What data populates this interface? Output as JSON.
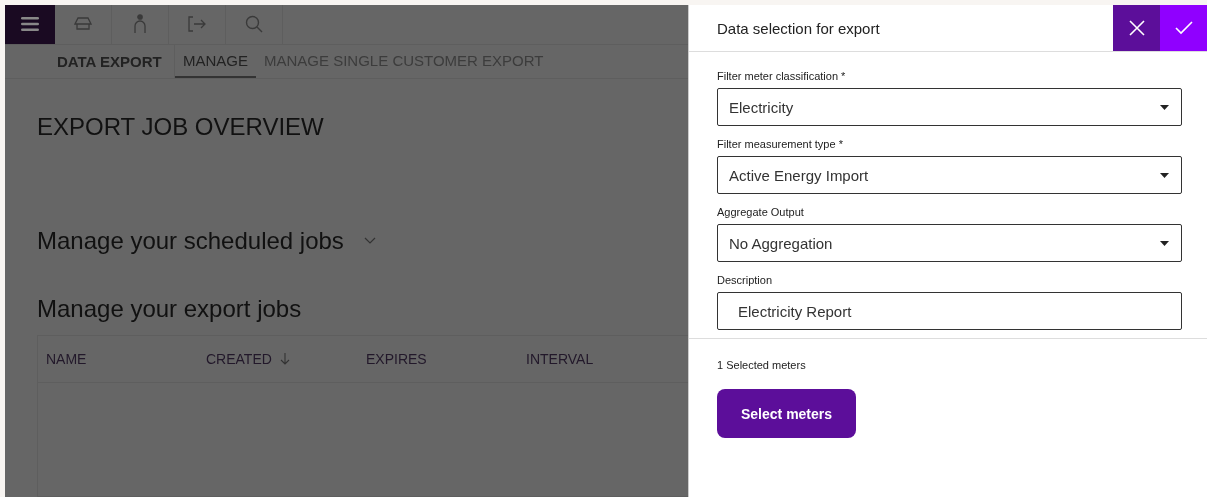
{
  "app_tabs": [
    {
      "label": "DATA EXPORT",
      "kind": "section"
    },
    {
      "label": "MANAGE",
      "kind": "tab",
      "selected": true
    },
    {
      "label": "MANAGE SINGLE CUSTOMER EXPORT",
      "kind": "tab",
      "selected": false
    }
  ],
  "page_title": "EXPORT JOB OVERVIEW",
  "scheduled_heading": "Manage your scheduled jobs",
  "export_heading": "Manage your export jobs",
  "table": {
    "columns": [
      {
        "label": "NAME",
        "sorted": false
      },
      {
        "label": "CREATED",
        "sorted": true
      },
      {
        "label": "EXPIRES",
        "sorted": false
      },
      {
        "label": "INTERVAL",
        "sorted": false
      }
    ]
  },
  "panel": {
    "title": "Data selection for export",
    "fields": [
      {
        "label": "Filter meter classification *",
        "kind": "dropdown",
        "value": "Electricity"
      },
      {
        "label": "Filter measurement type *",
        "kind": "dropdown",
        "value": "Active Energy Import"
      },
      {
        "label": "Aggregate Output",
        "kind": "dropdown",
        "value": "No Aggregation"
      },
      {
        "label": "Description",
        "kind": "text",
        "value": "Electricity Report"
      }
    ],
    "selected_count": "1 Selected meters",
    "select_button": "Select meters"
  }
}
